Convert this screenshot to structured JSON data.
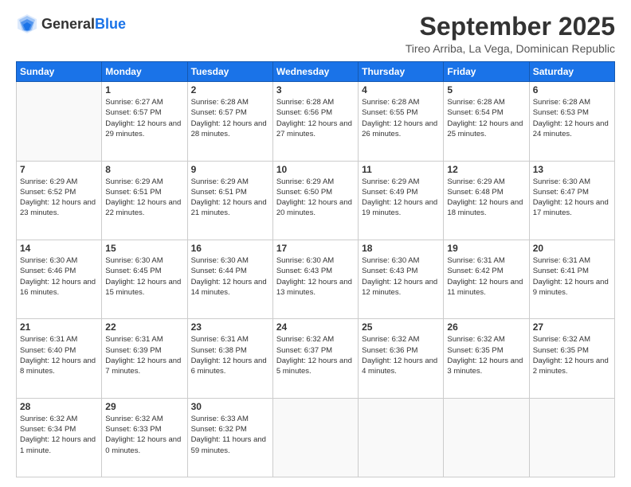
{
  "header": {
    "logo_general": "General",
    "logo_blue": "Blue",
    "month": "September 2025",
    "location": "Tireo Arriba, La Vega, Dominican Republic"
  },
  "weekdays": [
    "Sunday",
    "Monday",
    "Tuesday",
    "Wednesday",
    "Thursday",
    "Friday",
    "Saturday"
  ],
  "weeks": [
    [
      {
        "day": "",
        "sunrise": "",
        "sunset": "",
        "daylight": ""
      },
      {
        "day": "1",
        "sunrise": "Sunrise: 6:27 AM",
        "sunset": "Sunset: 6:57 PM",
        "daylight": "Daylight: 12 hours and 29 minutes."
      },
      {
        "day": "2",
        "sunrise": "Sunrise: 6:28 AM",
        "sunset": "Sunset: 6:57 PM",
        "daylight": "Daylight: 12 hours and 28 minutes."
      },
      {
        "day": "3",
        "sunrise": "Sunrise: 6:28 AM",
        "sunset": "Sunset: 6:56 PM",
        "daylight": "Daylight: 12 hours and 27 minutes."
      },
      {
        "day": "4",
        "sunrise": "Sunrise: 6:28 AM",
        "sunset": "Sunset: 6:55 PM",
        "daylight": "Daylight: 12 hours and 26 minutes."
      },
      {
        "day": "5",
        "sunrise": "Sunrise: 6:28 AM",
        "sunset": "Sunset: 6:54 PM",
        "daylight": "Daylight: 12 hours and 25 minutes."
      },
      {
        "day": "6",
        "sunrise": "Sunrise: 6:28 AM",
        "sunset": "Sunset: 6:53 PM",
        "daylight": "Daylight: 12 hours and 24 minutes."
      }
    ],
    [
      {
        "day": "7",
        "sunrise": "Sunrise: 6:29 AM",
        "sunset": "Sunset: 6:52 PM",
        "daylight": "Daylight: 12 hours and 23 minutes."
      },
      {
        "day": "8",
        "sunrise": "Sunrise: 6:29 AM",
        "sunset": "Sunset: 6:51 PM",
        "daylight": "Daylight: 12 hours and 22 minutes."
      },
      {
        "day": "9",
        "sunrise": "Sunrise: 6:29 AM",
        "sunset": "Sunset: 6:51 PM",
        "daylight": "Daylight: 12 hours and 21 minutes."
      },
      {
        "day": "10",
        "sunrise": "Sunrise: 6:29 AM",
        "sunset": "Sunset: 6:50 PM",
        "daylight": "Daylight: 12 hours and 20 minutes."
      },
      {
        "day": "11",
        "sunrise": "Sunrise: 6:29 AM",
        "sunset": "Sunset: 6:49 PM",
        "daylight": "Daylight: 12 hours and 19 minutes."
      },
      {
        "day": "12",
        "sunrise": "Sunrise: 6:29 AM",
        "sunset": "Sunset: 6:48 PM",
        "daylight": "Daylight: 12 hours and 18 minutes."
      },
      {
        "day": "13",
        "sunrise": "Sunrise: 6:30 AM",
        "sunset": "Sunset: 6:47 PM",
        "daylight": "Daylight: 12 hours and 17 minutes."
      }
    ],
    [
      {
        "day": "14",
        "sunrise": "Sunrise: 6:30 AM",
        "sunset": "Sunset: 6:46 PM",
        "daylight": "Daylight: 12 hours and 16 minutes."
      },
      {
        "day": "15",
        "sunrise": "Sunrise: 6:30 AM",
        "sunset": "Sunset: 6:45 PM",
        "daylight": "Daylight: 12 hours and 15 minutes."
      },
      {
        "day": "16",
        "sunrise": "Sunrise: 6:30 AM",
        "sunset": "Sunset: 6:44 PM",
        "daylight": "Daylight: 12 hours and 14 minutes."
      },
      {
        "day": "17",
        "sunrise": "Sunrise: 6:30 AM",
        "sunset": "Sunset: 6:43 PM",
        "daylight": "Daylight: 12 hours and 13 minutes."
      },
      {
        "day": "18",
        "sunrise": "Sunrise: 6:30 AM",
        "sunset": "Sunset: 6:43 PM",
        "daylight": "Daylight: 12 hours and 12 minutes."
      },
      {
        "day": "19",
        "sunrise": "Sunrise: 6:31 AM",
        "sunset": "Sunset: 6:42 PM",
        "daylight": "Daylight: 12 hours and 11 minutes."
      },
      {
        "day": "20",
        "sunrise": "Sunrise: 6:31 AM",
        "sunset": "Sunset: 6:41 PM",
        "daylight": "Daylight: 12 hours and 9 minutes."
      }
    ],
    [
      {
        "day": "21",
        "sunrise": "Sunrise: 6:31 AM",
        "sunset": "Sunset: 6:40 PM",
        "daylight": "Daylight: 12 hours and 8 minutes."
      },
      {
        "day": "22",
        "sunrise": "Sunrise: 6:31 AM",
        "sunset": "Sunset: 6:39 PM",
        "daylight": "Daylight: 12 hours and 7 minutes."
      },
      {
        "day": "23",
        "sunrise": "Sunrise: 6:31 AM",
        "sunset": "Sunset: 6:38 PM",
        "daylight": "Daylight: 12 hours and 6 minutes."
      },
      {
        "day": "24",
        "sunrise": "Sunrise: 6:32 AM",
        "sunset": "Sunset: 6:37 PM",
        "daylight": "Daylight: 12 hours and 5 minutes."
      },
      {
        "day": "25",
        "sunrise": "Sunrise: 6:32 AM",
        "sunset": "Sunset: 6:36 PM",
        "daylight": "Daylight: 12 hours and 4 minutes."
      },
      {
        "day": "26",
        "sunrise": "Sunrise: 6:32 AM",
        "sunset": "Sunset: 6:35 PM",
        "daylight": "Daylight: 12 hours and 3 minutes."
      },
      {
        "day": "27",
        "sunrise": "Sunrise: 6:32 AM",
        "sunset": "Sunset: 6:35 PM",
        "daylight": "Daylight: 12 hours and 2 minutes."
      }
    ],
    [
      {
        "day": "28",
        "sunrise": "Sunrise: 6:32 AM",
        "sunset": "Sunset: 6:34 PM",
        "daylight": "Daylight: 12 hours and 1 minute."
      },
      {
        "day": "29",
        "sunrise": "Sunrise: 6:32 AM",
        "sunset": "Sunset: 6:33 PM",
        "daylight": "Daylight: 12 hours and 0 minutes."
      },
      {
        "day": "30",
        "sunrise": "Sunrise: 6:33 AM",
        "sunset": "Sunset: 6:32 PM",
        "daylight": "Daylight: 11 hours and 59 minutes."
      },
      {
        "day": "",
        "sunrise": "",
        "sunset": "",
        "daylight": ""
      },
      {
        "day": "",
        "sunrise": "",
        "sunset": "",
        "daylight": ""
      },
      {
        "day": "",
        "sunrise": "",
        "sunset": "",
        "daylight": ""
      },
      {
        "day": "",
        "sunrise": "",
        "sunset": "",
        "daylight": ""
      }
    ]
  ]
}
